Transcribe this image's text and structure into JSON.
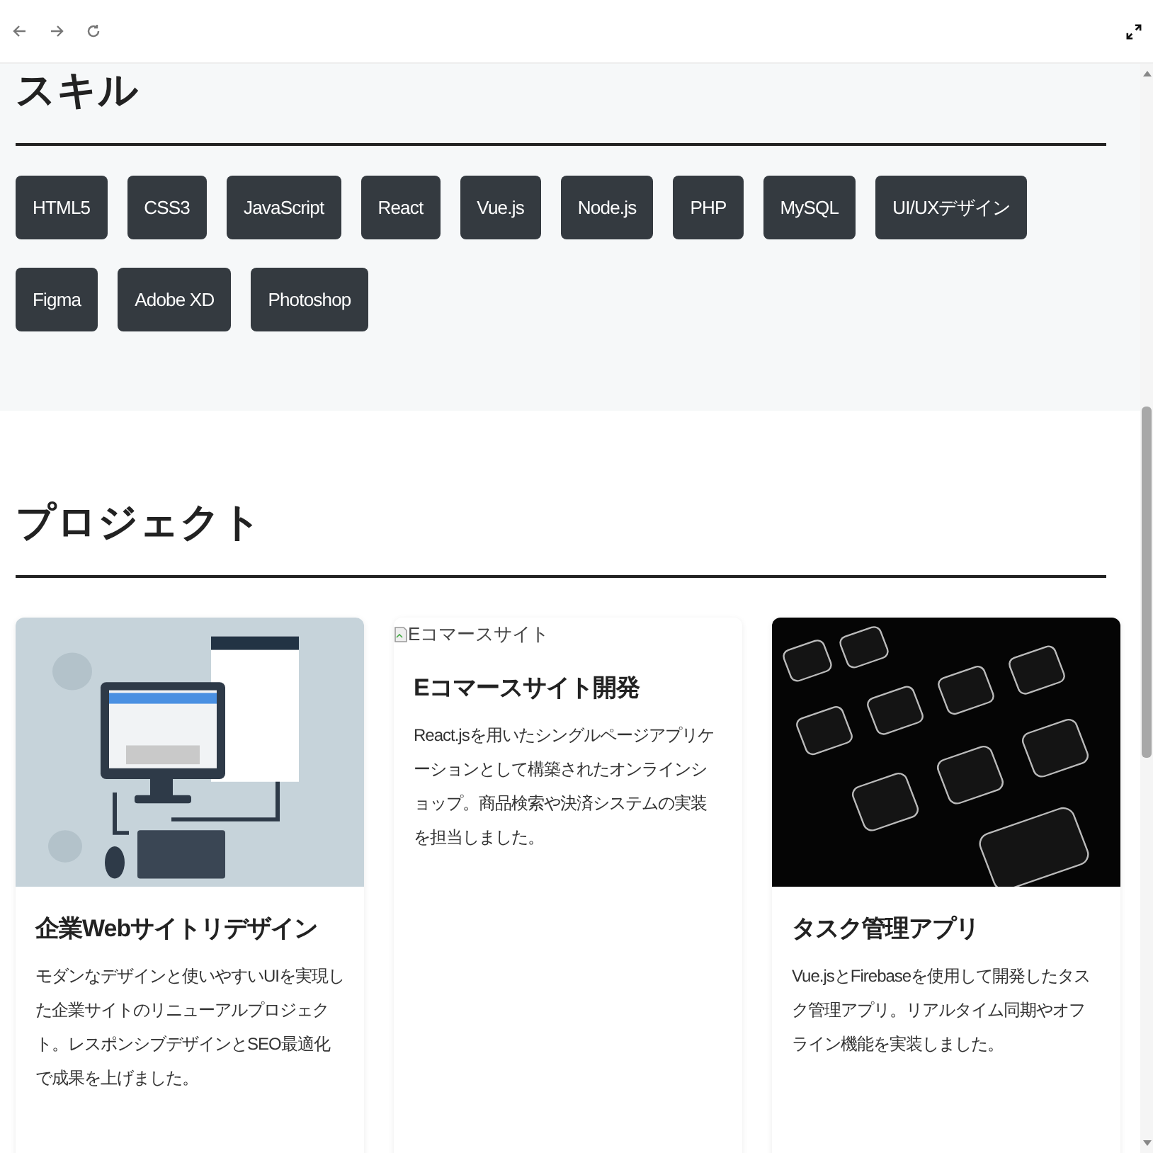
{
  "skills": {
    "title": "スキル",
    "tags": [
      "HTML5",
      "CSS3",
      "JavaScript",
      "React",
      "Vue.js",
      "Node.js",
      "PHP",
      "MySQL",
      "UI/UXデザイン",
      "Figma",
      "Adobe XD",
      "Photoshop"
    ]
  },
  "projects": {
    "title": "プロジェクト",
    "cards": [
      {
        "kind": "illustration",
        "title": "企業Webサイトリデザイン",
        "text": "モダンなデザインと使いやすいUIを実現した企業サイトのリニューアルプロジェクト。レスポンシブデザインとSEO最適化で成果を上げました。"
      },
      {
        "kind": "broken",
        "alt": "Eコマースサイト",
        "title": "Eコマースサイト開発",
        "text": "React.jsを用いたシングルページアプリケーションとして構築されたオンラインショップ。商品検索や決済システムの実装を担当しました。"
      },
      {
        "title": "タスク管理アプリ",
        "text": "Vue.jsとFirebaseを使用して開発したタスク管理アプリ。リアルタイム同期やオフライン機能を実装しました。"
      }
    ]
  }
}
